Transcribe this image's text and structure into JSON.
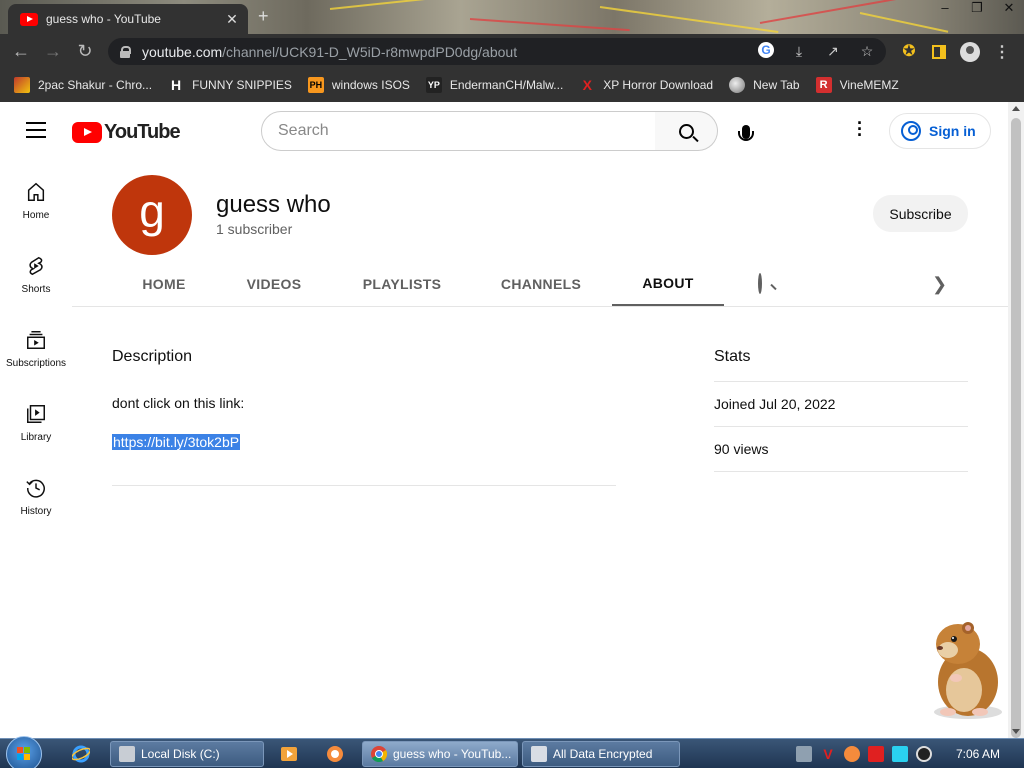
{
  "browser": {
    "tab_title": "guess who - YouTube",
    "tab_close": "✕",
    "new_tab": "+",
    "window_min": "–",
    "window_max": "❐",
    "window_close": "✕",
    "url_host": "youtube.com",
    "url_path": "/channel/UCK91-D_W5iD-r8mwpdPD0dg/about",
    "bookmarks": [
      {
        "label": "2pac Shakur - Chro...",
        "icon": "letter-icon",
        "glyph": "",
        "color": "#ffffff"
      },
      {
        "label": "FUNNY SNIPPIES",
        "icon": "h-icon",
        "glyph": "H",
        "color": "#ffffff"
      },
      {
        "label": "windows ISOS",
        "icon": "ph-icon",
        "glyph": "PH",
        "color": "#f7971e"
      },
      {
        "label": "EndermanCH/Malw...",
        "icon": "yp-icon",
        "glyph": "YP",
        "color": "#222222"
      },
      {
        "label": "XP Horror Download",
        "icon": "x-icon",
        "glyph": "X",
        "color": "#e02020"
      },
      {
        "label": "New Tab",
        "icon": "globe-icon",
        "glyph": "",
        "color": "#cccccc"
      },
      {
        "label": "VineMEMZ",
        "icon": "r-icon",
        "glyph": "R",
        "color": "#d32f2f"
      }
    ]
  },
  "youtube": {
    "logo_text": "YouTube",
    "search_placeholder": "Search",
    "sign_in": "Sign in",
    "guide": [
      {
        "label": "Home",
        "icon": "home-icon"
      },
      {
        "label": "Shorts",
        "icon": "shorts-icon"
      },
      {
        "label": "Subscriptions",
        "icon": "subscriptions-icon"
      },
      {
        "label": "Library",
        "icon": "library-icon"
      },
      {
        "label": "History",
        "icon": "history-icon"
      }
    ]
  },
  "channel": {
    "avatar_letter": "g",
    "avatar_color": "#bf360c",
    "name": "guess who",
    "subscribers": "1 subscriber",
    "subscribe_label": "Subscribe",
    "tabs": [
      "HOME",
      "VIDEOS",
      "PLAYLISTS",
      "CHANNELS",
      "ABOUT"
    ],
    "active_tab": "ABOUT"
  },
  "about": {
    "description_heading": "Description",
    "description_text": "dont click on this link:",
    "description_link": "https://bit.ly/3tok2bP",
    "stats_heading": "Stats",
    "joined": "Joined Jul 20, 2022",
    "views": "90 views"
  },
  "taskbar": {
    "tasks": [
      {
        "label": "Local Disk (C:)",
        "icon": "folder-icon"
      },
      {
        "label": "guess who - YouTub...",
        "icon": "chrome-icon"
      },
      {
        "label": "All Data Encrypted",
        "icon": "window-icon"
      }
    ],
    "clock": "7:06 AM"
  },
  "colors": {
    "youtube_red": "#ff0000",
    "link_highlight": "#3b82e6",
    "signin_blue": "#065fd4"
  }
}
